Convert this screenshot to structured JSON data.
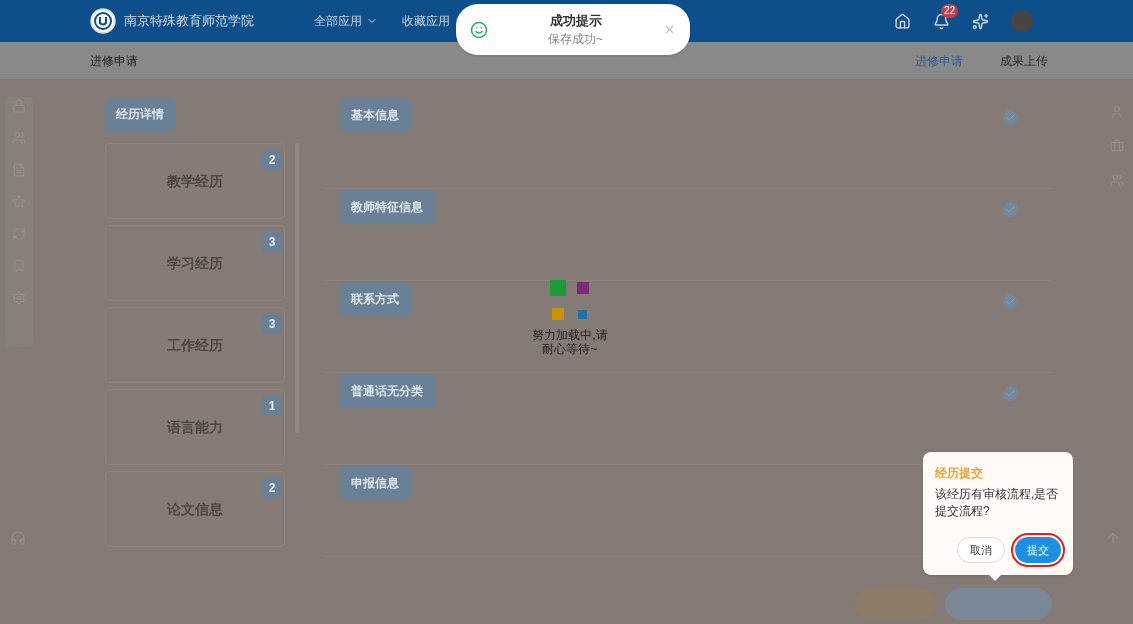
{
  "header": {
    "school_name": "南京特殊教育师范学院",
    "menus": [
      {
        "label": "全部应用"
      },
      {
        "label": "收藏应用"
      }
    ],
    "notification_count": "22"
  },
  "toast": {
    "title": "成功提示",
    "message": "保存成功~"
  },
  "subheader": {
    "title": "进修申请",
    "tabs": [
      {
        "label": "进修申请",
        "selected": true
      },
      {
        "label": "成果上传",
        "selected": false
      }
    ]
  },
  "experience": {
    "heading": "经历详情",
    "items": [
      {
        "label": "教学经历",
        "count": "2"
      },
      {
        "label": "学习经历",
        "count": "3"
      },
      {
        "label": "工作经历",
        "count": "3"
      },
      {
        "label": "语言能力",
        "count": "1"
      },
      {
        "label": "论文信息",
        "count": "2"
      }
    ]
  },
  "sections": [
    {
      "label": "基本信息"
    },
    {
      "label": "教师特征信息"
    },
    {
      "label": "联系方式"
    },
    {
      "label": "普通话无分类"
    },
    {
      "label": "申报信息"
    }
  ],
  "loading": {
    "message": "努力加载中,请耐心等待~"
  },
  "confirm": {
    "title": "经历提交",
    "message": "该经历有审核流程,是否提交流程?",
    "buttons": [
      {
        "label": "取消",
        "kind": "cancel"
      },
      {
        "label": "提交",
        "kind": "primary"
      }
    ]
  }
}
